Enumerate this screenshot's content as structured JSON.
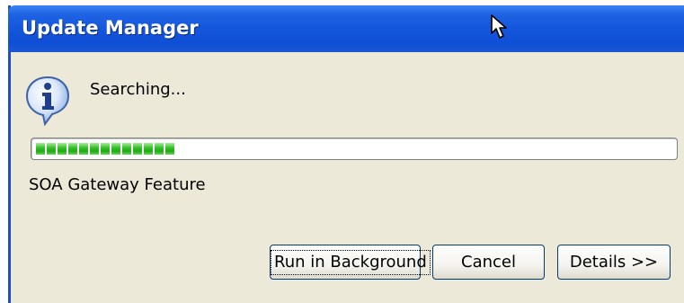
{
  "window": {
    "title": "Update Manager"
  },
  "dialog": {
    "icon": "info-icon",
    "status": "Searching...",
    "progress": {
      "filled_segments": 13
    },
    "feature": "SOA Gateway Feature"
  },
  "buttons": {
    "run_in_background": "Run in Background",
    "cancel": "Cancel",
    "details": "Details >>"
  },
  "colors": {
    "titlebar": "#1456dc",
    "dialog_bg": "#ece9d8",
    "progress_fill": "#22a816",
    "button_border": "#003c74"
  }
}
